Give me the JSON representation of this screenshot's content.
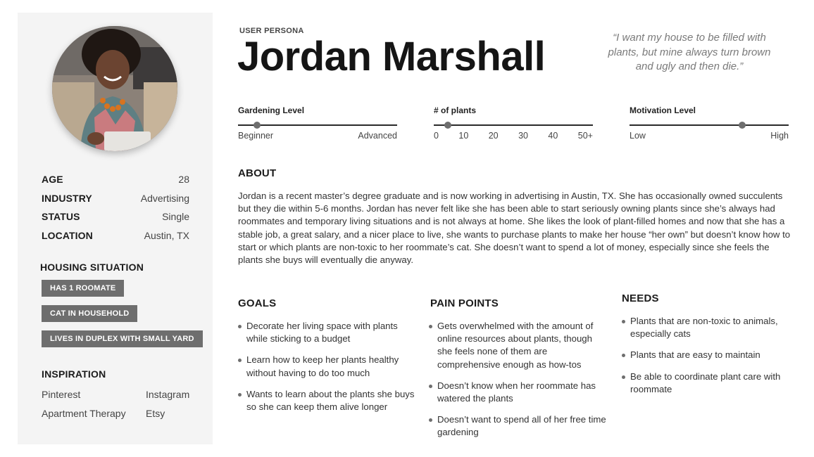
{
  "persona": {
    "eyebrow": "USER PERSONA",
    "name": "Jordan Marshall",
    "quote": "“I want my house to be filled with plants, but mine always turn brown and ugly and then die.”"
  },
  "facts": [
    {
      "label": "AGE",
      "value": "28"
    },
    {
      "label": "INDUSTRY",
      "value": "Advertising"
    },
    {
      "label": "STATUS",
      "value": "Single"
    },
    {
      "label": "LOCATION",
      "value": "Austin, TX"
    }
  ],
  "housing": {
    "title": "HOUSING SITUATION",
    "tags": [
      "HAS 1 ROOMATE",
      "CAT IN HOUSEHOLD",
      "LIVES IN DUPLEX WITH SMALL YARD"
    ]
  },
  "inspiration": {
    "title": "INSPIRATION",
    "rows": [
      [
        "Pinterest",
        "Instagram"
      ],
      [
        "Apartment Therapy",
        "Etsy"
      ]
    ]
  },
  "sliders": {
    "gardening": {
      "title": "Gardening Level",
      "min_label": "Beginner",
      "max_label": "Advanced",
      "level": 0.12
    },
    "plants": {
      "title": "# of plants",
      "ticks": [
        "0",
        "10",
        "20",
        "30",
        "40",
        "50+"
      ],
      "level": 0.09
    },
    "motivation": {
      "title": "Motivation Level",
      "min_label": "Low",
      "max_label": "High",
      "level": 0.71
    }
  },
  "about": {
    "title": "ABOUT",
    "text": "Jordan is a recent master’s degree graduate and is now working in advertising in Austin, TX. She has occasionally owned succulents but they die within 5-6 months. Jordan has never felt like she has been able to start seriously owning plants since she’s always had roommates and temporary living situations and is not always at home. She likes the look of plant-filled homes and now that she has a stable job, a great salary, and a nicer place to live, she wants to purchase plants to make her house “her own” but doesn’t know how to start or which plants are non-toxic to her roommate’s cat. She doesn’t want to spend a lot of money, especially since she feels the plants she buys will eventually die anyway."
  },
  "goals": {
    "title": "GOALS",
    "items": [
      "Decorate her living space with plants while sticking to a budget",
      "Learn how to keep her plants healthy without having to do too much",
      "Wants to learn about the plants she buys so she can keep them alive longer"
    ]
  },
  "pain_points": {
    "title": "PAIN POINTS",
    "items": [
      "Gets overwhelmed with the amount of online resources about plants, though she feels none of them are comprehensive enough as how-tos",
      "Doesn’t know when her roommate has watered the plants",
      "Doesn’t want to spend all of her free time gardening"
    ]
  },
  "needs": {
    "title": "NEEDS",
    "items": [
      "Plants that are non-toxic to animals, especially cats",
      "Plants that are easy to maintain",
      "Be able to coordinate plant care with roommate"
    ]
  }
}
